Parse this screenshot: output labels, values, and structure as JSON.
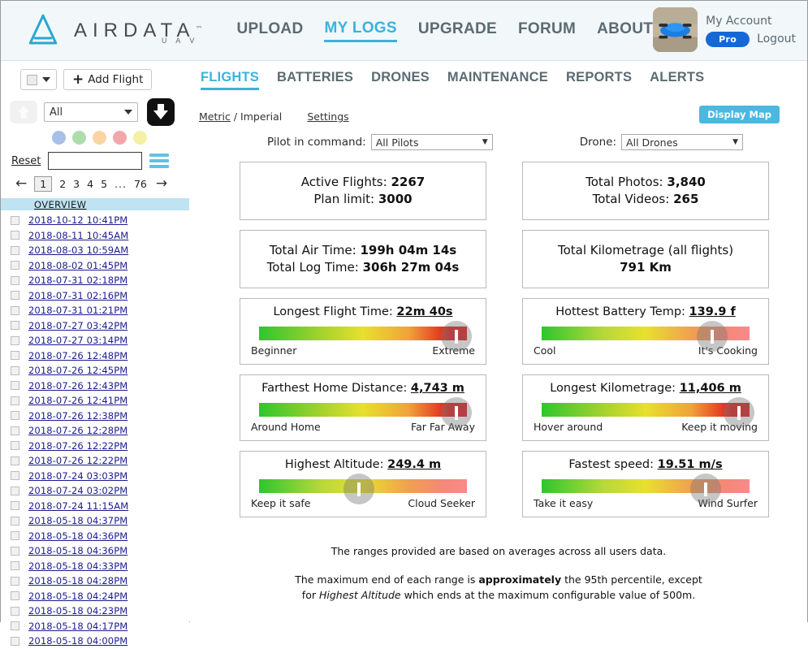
{
  "header": {
    "logo": {
      "word": "AIRDATA",
      "tm": "™",
      "sub": "U A V"
    },
    "nav": [
      {
        "label": "UPLOAD",
        "active": false
      },
      {
        "label": "MY LOGS",
        "active": true
      },
      {
        "label": "UPGRADE",
        "active": false
      },
      {
        "label": "FORUM",
        "active": false
      },
      {
        "label": "ABOUT",
        "active": false
      }
    ],
    "account": {
      "name": "My Account",
      "badge": "Pro",
      "logout": "Logout"
    }
  },
  "sidebar": {
    "select_dropdown_label": "",
    "add_flight_label": "Add Flight",
    "add_flight_plus": "+",
    "filter_select_value": "All",
    "upload_icon": "upload-cloud-icon",
    "download_icon": "download-icon",
    "color_dots": [
      "#a8c0e8",
      "#aeddac",
      "#fad4a2",
      "#f2a7aa",
      "#f4f0a4"
    ],
    "reset_label": "Reset",
    "search_value": "",
    "menu_icon": "hamburger-icon",
    "pager": {
      "prev": "←",
      "next": "→",
      "pages": [
        "1",
        "2",
        "3",
        "4",
        "5"
      ],
      "ellipsis": "...",
      "last": "76",
      "current": "1"
    },
    "overview_label": "OVERVIEW",
    "flights": [
      "2018-10-12 10:41PM",
      "2018-08-11 10:45AM",
      "2018-08-03 10:59AM",
      "2018-08-02 01:45PM",
      "2018-07-31 02:18PM",
      "2018-07-31 02:16PM",
      "2018-07-31 01:21PM",
      "2018-07-27 03:42PM",
      "2018-07-27 03:14PM",
      "2018-07-26 12:48PM",
      "2018-07-26 12:45PM",
      "2018-07-26 12:43PM",
      "2018-07-26 12:41PM",
      "2018-07-26 12:38PM",
      "2018-07-26 12:28PM",
      "2018-07-26 12:22PM",
      "2018-07-26 12:22PM",
      "2018-07-24 03:03PM",
      "2018-07-24 03:02PM",
      "2018-07-24 11:15AM",
      "2018-05-18 04:37PM",
      "2018-05-18 04:36PM",
      "2018-05-18 04:36PM",
      "2018-05-18 04:33PM",
      "2018-05-18 04:28PM",
      "2018-05-18 04:24PM",
      "2018-05-18 04:23PM",
      "2018-05-18 04:17PM",
      "2018-05-18 04:00PM"
    ]
  },
  "main": {
    "tabs": [
      {
        "label": "FLIGHTS",
        "active": true
      },
      {
        "label": "BATTERIES",
        "active": false
      },
      {
        "label": "DRONES",
        "active": false
      },
      {
        "label": "MAINTENANCE",
        "active": false
      },
      {
        "label": "REPORTS",
        "active": false
      },
      {
        "label": "ALERTS",
        "active": false
      }
    ],
    "units": {
      "metric": "Metric",
      "separator": " / ",
      "imperial": "Imperial"
    },
    "settings_label": "Settings",
    "display_map_label": "Display Map",
    "filters": {
      "pilot_label": "Pilot in command:",
      "pilot_value": "All Pilots",
      "drone_label": "Drone:",
      "drone_value": "All Drones"
    },
    "stats": {
      "active_flights_label": "Active Flights:",
      "active_flights_value": "2267",
      "plan_limit_label": "Plan limit:",
      "plan_limit_value": "3000",
      "total_photos_label": "Total Photos:",
      "total_photos_value": "3,840",
      "total_videos_label": "Total Videos:",
      "total_videos_value": "265",
      "total_air_time_label": "Total Air Time:",
      "total_air_time_value": "199h 04m 14s",
      "total_log_time_label": "Total Log Time:",
      "total_log_time_value": "306h 27m 04s",
      "total_km_label": "Total Kilometrage (all flights)",
      "total_km_value": "791 Km"
    },
    "gauges_left": [
      {
        "title": "Longest Flight Time:",
        "value": "22m 40s",
        "min_label": "Beginner",
        "max_label": "Extreme",
        "percent": 95,
        "faded": false
      },
      {
        "title": "Farthest Home Distance:",
        "value": "4,743 m",
        "min_label": "Around Home",
        "max_label": "Far Far Away",
        "percent": 95,
        "faded": false
      },
      {
        "title": "Highest Altitude:",
        "value": "249.4 m",
        "min_label": "Keep it safe",
        "max_label": "Cloud Seeker",
        "percent": 48,
        "faded": true
      }
    ],
    "gauges_right": [
      {
        "title": "Hottest Battery Temp:",
        "value": "139.9 f",
        "min_label": "Cool",
        "max_label": "It's Cooking",
        "percent": 82,
        "faded": true
      },
      {
        "title": "Longest Kilometrage:",
        "value": "11,406 m",
        "min_label": "Hover around",
        "max_label": "Keep it moving",
        "percent": 95,
        "faded": false
      },
      {
        "title": "Fastest speed:",
        "value": "19.51 m/s",
        "min_label": "Take it easy",
        "max_label": "Wind Surfer",
        "percent": 79,
        "faded": true
      }
    ],
    "notes": {
      "line1": "The ranges provided are based on averages across all users data.",
      "line2a": "The maximum end of each range is ",
      "line2b": "approximately",
      "line2c": " the 95th percentile, except",
      "line3a": "for ",
      "line3b": "Highest Altitude",
      "line3c": " which ends at the maximum configurable value of 500m."
    }
  },
  "colors": {
    "accent": "#3ab3dc",
    "brand_logo": "#2aa7cf",
    "pro_badge": "#1569d6",
    "link": "#1b1b8f",
    "overview_bar": "#bfe3f2",
    "gauge_green": "#2ec62e",
    "gauge_yellow": "#e8e02e",
    "gauge_red": "#e01b1b"
  }
}
